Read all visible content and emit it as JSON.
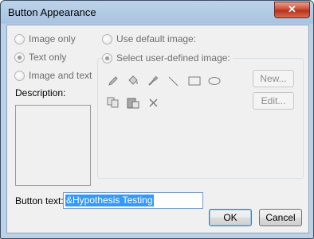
{
  "window": {
    "title": "Button Appearance",
    "close_glyph": "✕"
  },
  "radios": {
    "image_only": "Image only",
    "text_only": "Text only",
    "image_and_text": "Image and text",
    "use_default": "Use default image:",
    "select_user": "Select user-defined image:",
    "selected_left": "text_only",
    "selected_right": "select_user"
  },
  "description_label": "Description:",
  "icons": [
    "pencil-icon",
    "paint-bucket-icon",
    "eyedropper-icon",
    "line-icon",
    "rectangle-icon",
    "ellipse-icon",
    "copy-icon",
    "paste-icon",
    "delete-icon"
  ],
  "side_buttons": {
    "new": "New...",
    "edit": "Edit..."
  },
  "button_text": {
    "label": "Button text:",
    "value": "&Hypothesis Testing"
  },
  "actions": {
    "ok": "OK",
    "cancel": "Cancel"
  }
}
